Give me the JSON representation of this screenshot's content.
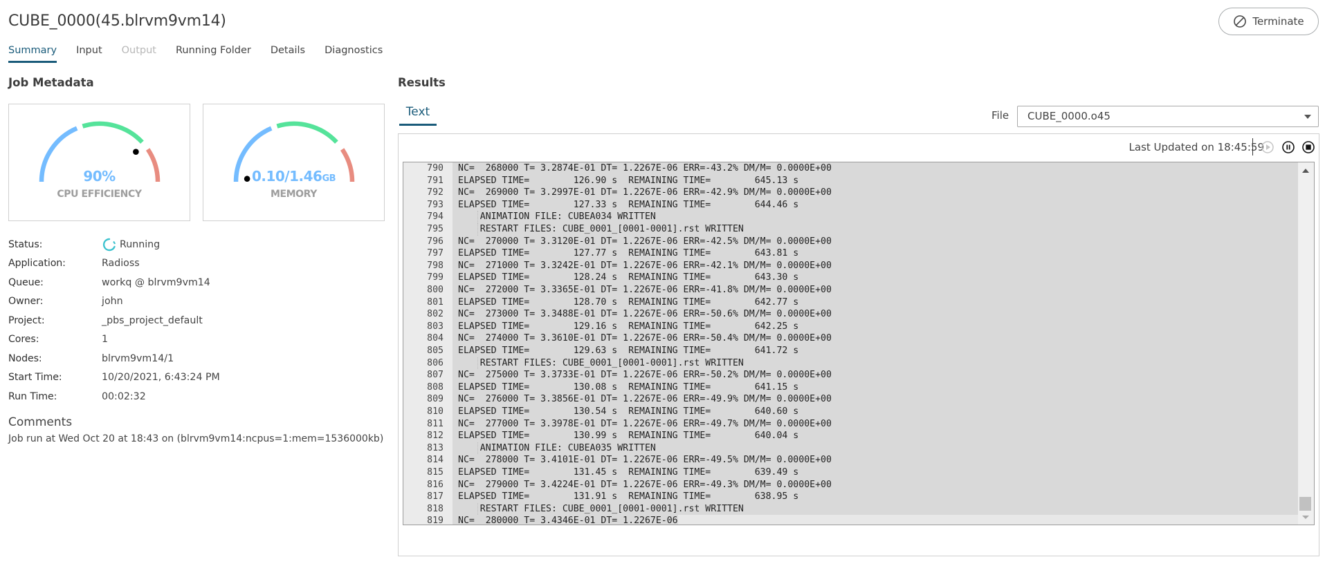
{
  "header": {
    "title": "CUBE_0000(45.blrvm9vm14)",
    "terminate_label": "Terminate"
  },
  "tabs": [
    {
      "label": "Summary",
      "state": "active"
    },
    {
      "label": "Input",
      "state": "normal"
    },
    {
      "label": "Output",
      "state": "disabled"
    },
    {
      "label": "Running Folder",
      "state": "normal"
    },
    {
      "label": "Details",
      "state": "normal"
    },
    {
      "label": "Diagnostics",
      "state": "normal"
    }
  ],
  "job_metadata": {
    "heading": "Job Metadata",
    "gauges": [
      {
        "label": "CPU EFFICIENCY",
        "value": "90%",
        "unit": "",
        "fraction": 0.78
      },
      {
        "label": "MEMORY",
        "value": "0.10/1.46",
        "unit": "GB",
        "fraction": 0.02
      }
    ],
    "gauge_colors": {
      "low": "#74bcff",
      "mid": "#55e39a",
      "high": "#e88c80",
      "needle": "#000000"
    },
    "fields": [
      {
        "label": "Status:",
        "value": "Running",
        "icon": "spinner-icon"
      },
      {
        "label": "Application:",
        "value": "Radioss"
      },
      {
        "label": "Queue:",
        "value": "workq @ blrvm9vm14"
      },
      {
        "label": "Owner:",
        "value": "john"
      },
      {
        "label": "Project:",
        "value": "_pbs_project_default"
      },
      {
        "label": "Cores:",
        "value": "1"
      },
      {
        "label": "Nodes:",
        "value": "blrvm9vm14/1"
      },
      {
        "label": "Start Time:",
        "value": "10/20/2021, 6:43:24 PM"
      },
      {
        "label": "Run Time:",
        "value": "00:02:32"
      }
    ],
    "comments_heading": "Comments",
    "comments_text": "Job run at Wed Oct 20 at 18:43 on (blrvm9vm14:ncpus=1:mem=1536000kb)"
  },
  "results": {
    "heading": "Results",
    "view_tab": "Text",
    "file_label": "File",
    "file_selected": "CUBE_0000.o45",
    "last_updated": "Last Updated on 18:45:59",
    "controls": [
      {
        "name": "play-icon",
        "enabled": false
      },
      {
        "name": "pause-icon",
        "enabled": true
      },
      {
        "name": "stop-icon",
        "enabled": true
      }
    ],
    "lines": [
      {
        "n": "790",
        "t": "NC=  268000 T= 3.2874E-01 DT= 1.2267E-06 ERR=-43.2% DM/M= 0.0000E+00"
      },
      {
        "n": "791",
        "t": "ELAPSED TIME=        126.90 s  REMAINING TIME=        645.13 s"
      },
      {
        "n": "792",
        "t": "NC=  269000 T= 3.2997E-01 DT= 1.2267E-06 ERR=-42.9% DM/M= 0.0000E+00"
      },
      {
        "n": "793",
        "t": "ELAPSED TIME=        127.33 s  REMAINING TIME=        644.46 s"
      },
      {
        "n": "794",
        "t": "    ANIMATION FILE: CUBEA034 WRITTEN"
      },
      {
        "n": "795",
        "t": "    RESTART FILES: CUBE_0001_[0001-0001].rst WRITTEN"
      },
      {
        "n": "796",
        "t": "NC=  270000 T= 3.3120E-01 DT= 1.2267E-06 ERR=-42.5% DM/M= 0.0000E+00"
      },
      {
        "n": "797",
        "t": "ELAPSED TIME=        127.77 s  REMAINING TIME=        643.81 s"
      },
      {
        "n": "798",
        "t": "NC=  271000 T= 3.3242E-01 DT= 1.2267E-06 ERR=-42.1% DM/M= 0.0000E+00"
      },
      {
        "n": "799",
        "t": "ELAPSED TIME=        128.24 s  REMAINING TIME=        643.30 s"
      },
      {
        "n": "800",
        "t": "NC=  272000 T= 3.3365E-01 DT= 1.2267E-06 ERR=-41.8% DM/M= 0.0000E+00"
      },
      {
        "n": "801",
        "t": "ELAPSED TIME=        128.70 s  REMAINING TIME=        642.77 s"
      },
      {
        "n": "802",
        "t": "NC=  273000 T= 3.3488E-01 DT= 1.2267E-06 ERR=-50.6% DM/M= 0.0000E+00"
      },
      {
        "n": "803",
        "t": "ELAPSED TIME=        129.16 s  REMAINING TIME=        642.25 s"
      },
      {
        "n": "804",
        "t": "NC=  274000 T= 3.3610E-01 DT= 1.2267E-06 ERR=-50.4% DM/M= 0.0000E+00"
      },
      {
        "n": "805",
        "t": "ELAPSED TIME=        129.63 s  REMAINING TIME=        641.72 s"
      },
      {
        "n": "806",
        "t": "    RESTART FILES: CUBE_0001_[0001-0001].rst WRITTEN"
      },
      {
        "n": "807",
        "t": "NC=  275000 T= 3.3733E-01 DT= 1.2267E-06 ERR=-50.2% DM/M= 0.0000E+00"
      },
      {
        "n": "808",
        "t": "ELAPSED TIME=        130.08 s  REMAINING TIME=        641.15 s"
      },
      {
        "n": "809",
        "t": "NC=  276000 T= 3.3856E-01 DT= 1.2267E-06 ERR=-49.9% DM/M= 0.0000E+00"
      },
      {
        "n": "810",
        "t": "ELAPSED TIME=        130.54 s  REMAINING TIME=        640.60 s"
      },
      {
        "n": "811",
        "t": "NC=  277000 T= 3.3978E-01 DT= 1.2267E-06 ERR=-49.7% DM/M= 0.0000E+00"
      },
      {
        "n": "812",
        "t": "ELAPSED TIME=        130.99 s  REMAINING TIME=        640.04 s"
      },
      {
        "n": "813",
        "t": "    ANIMATION FILE: CUBEA035 WRITTEN"
      },
      {
        "n": "814",
        "t": "NC=  278000 T= 3.4101E-01 DT= 1.2267E-06 ERR=-49.5% DM/M= 0.0000E+00"
      },
      {
        "n": "815",
        "t": "ELAPSED TIME=        131.45 s  REMAINING TIME=        639.49 s"
      },
      {
        "n": "816",
        "t": "NC=  279000 T= 3.4224E-01 DT= 1.2267E-06 ERR=-49.3% DM/M= 0.0000E+00"
      },
      {
        "n": "817",
        "t": "ELAPSED TIME=        131.91 s  REMAINING TIME=        638.95 s"
      },
      {
        "n": "818",
        "t": "    RESTART FILES: CUBE_0001_[0001-0001].rst WRITTEN"
      },
      {
        "n": "819",
        "t": "NC=  280000 T= 3.4346E-01 DT= 1.2267E-06"
      }
    ],
    "scroll_position": 0.97
  }
}
